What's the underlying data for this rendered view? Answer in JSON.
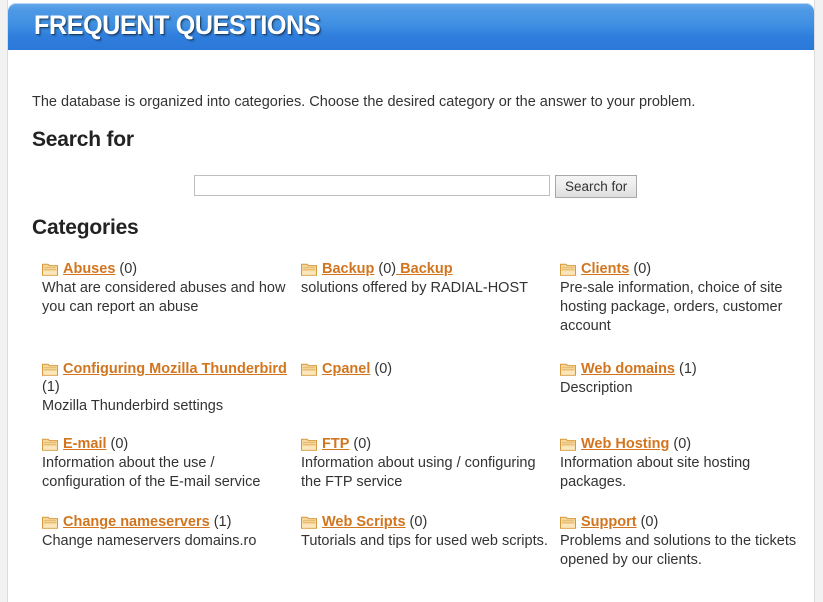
{
  "header": {
    "title": "FREQUENT QUESTIONS",
    "accent_color": "#3f8fe2"
  },
  "intro": "The database is organized into categories. Choose the desired category or the answer to your problem.",
  "search": {
    "heading": "Search for",
    "input_value": "",
    "input_placeholder": "",
    "button_label": "Search for"
  },
  "categories_heading": "Categories",
  "link_color": "#d2751e",
  "icon": "folder-icon",
  "categories": [
    {
      "name": "Abuses",
      "count": "(0)",
      "extra_link": "",
      "description": "What are considered abuses and how you can report an abuse"
    },
    {
      "name": "Backup",
      "count": "(0)",
      "extra_link": " Backup",
      "description": "solutions offered by RADIAL-HOST"
    },
    {
      "name": "Clients",
      "count": "(0)",
      "extra_link": "",
      "description": "Pre-sale information, choice of site hosting package, orders, customer account"
    },
    {
      "name": "Configuring Mozilla Thunderbird",
      "count": "(1)",
      "extra_link": "",
      "description": "Mozilla Thunderbird settings"
    },
    {
      "name": "Cpanel",
      "count": "(0)",
      "extra_link": "",
      "description": ""
    },
    {
      "name": "Web domains",
      "count": "(1)",
      "extra_link": "",
      "description": "Description"
    },
    {
      "name": "E-mail",
      "count": "(0)",
      "extra_link": "",
      "description": "Information about the use / configuration of the E-mail service"
    },
    {
      "name": "FTP",
      "count": "(0)",
      "extra_link": "",
      "description": "Information about using / configuring the FTP service"
    },
    {
      "name": "Web Hosting",
      "count": "(0)",
      "extra_link": "",
      "description": "Information about site hosting packages."
    },
    {
      "name": "Change nameservers",
      "count": "(1)",
      "extra_link": "",
      "description": "Change nameservers domains.ro"
    },
    {
      "name": "Web Scripts",
      "count": "(0)",
      "extra_link": "",
      "description": "Tutorials and tips for used web scripts."
    },
    {
      "name": "Support",
      "count": "(0)",
      "extra_link": "",
      "description": "Problems and solutions to the tickets opened by our clients."
    }
  ],
  "grid": {
    "columns": 3,
    "row_tops": [
      0,
      100,
      175,
      253
    ]
  }
}
